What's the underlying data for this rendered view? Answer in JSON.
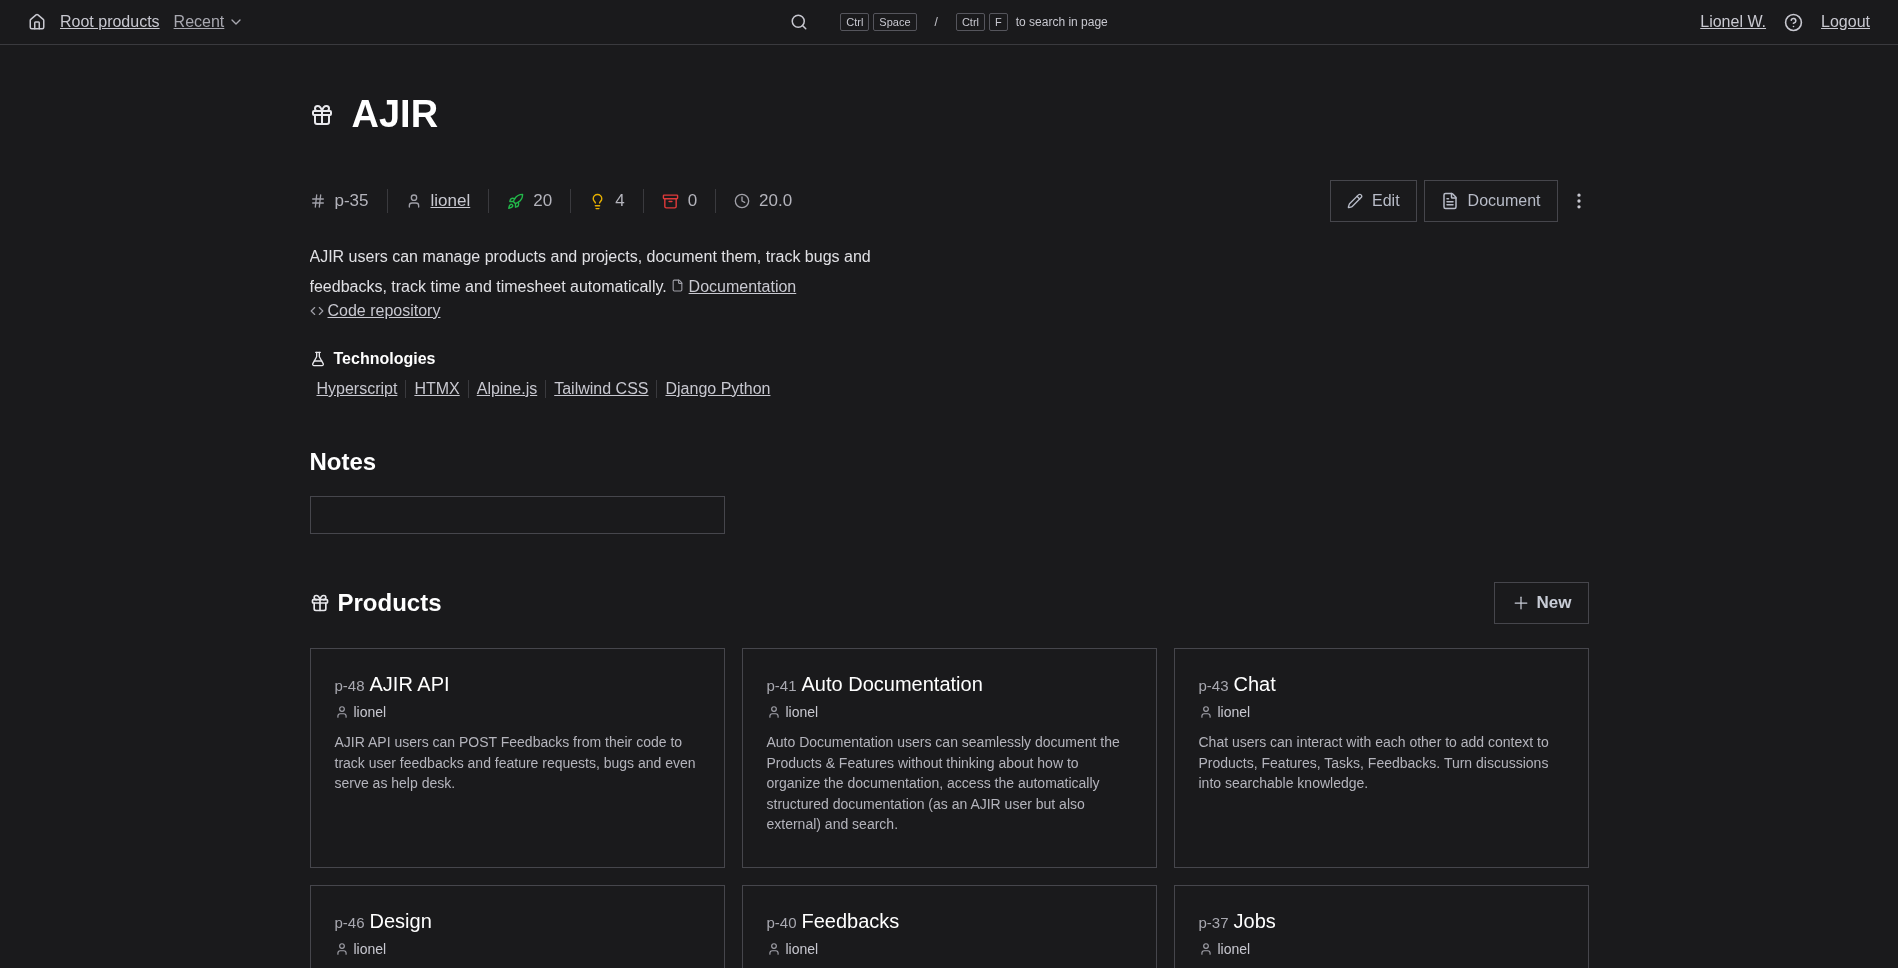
{
  "topbar": {
    "home_link": "Root products",
    "recent_menu": "Recent",
    "search_hint": {
      "shortcuts": [
        [
          "Ctrl",
          "Space"
        ],
        [
          "Ctrl",
          "F"
        ]
      ],
      "separator": "/",
      "text": "to search in page"
    },
    "user_link": "Lionel W.",
    "logout_link": "Logout"
  },
  "product": {
    "title": "AJIR",
    "meta": [
      {
        "kind": "id",
        "text": "p-35"
      },
      {
        "kind": "owner",
        "text": "lionel"
      },
      {
        "kind": "features",
        "text": "20"
      },
      {
        "kind": "ideas",
        "text": "4"
      },
      {
        "kind": "archived",
        "text": "0"
      },
      {
        "kind": "time",
        "text": "20.0"
      }
    ],
    "actions": [
      "Edit",
      "Document"
    ],
    "description": "AJIR users can manage products and projects, document them, track bugs and feedbacks, track time and timesheet automatically.",
    "documentation_link": "Documentation",
    "code_link": "Code repository",
    "technologies_title": "Technologies",
    "technologies": [
      "Hyperscript",
      "HTMX",
      "Alpine.js",
      "Tailwind CSS",
      "Django Python"
    ]
  },
  "notes": {
    "title": "Notes"
  },
  "products": {
    "title": "Products",
    "new_button": "New",
    "cards": [
      {
        "id": "p-48",
        "title": "AJIR API",
        "owner": "lionel",
        "description": "AJIR API users can POST Feedbacks from their code to track user feedbacks and feature requests, bugs and even serve as help desk."
      },
      {
        "id": "p-41",
        "title": "Auto Documentation",
        "owner": "lionel",
        "description": "Auto Documentation users can seamlessly document the Products & Features without thinking about how to organize the documentation, access the automatically structured documentation (as an AJIR user but also external) and search."
      },
      {
        "id": "p-43",
        "title": "Chat",
        "owner": "lionel",
        "description": "Chat users can interact with each other to add context to Products, Features, Tasks, Feedbacks. Turn discussions into searchable knowledge."
      },
      {
        "id": "p-46",
        "title": "Design",
        "owner": "lionel"
      },
      {
        "id": "p-40",
        "title": "Feedbacks",
        "owner": "lionel"
      },
      {
        "id": "p-37",
        "title": "Jobs",
        "owner": "lionel"
      }
    ]
  }
}
